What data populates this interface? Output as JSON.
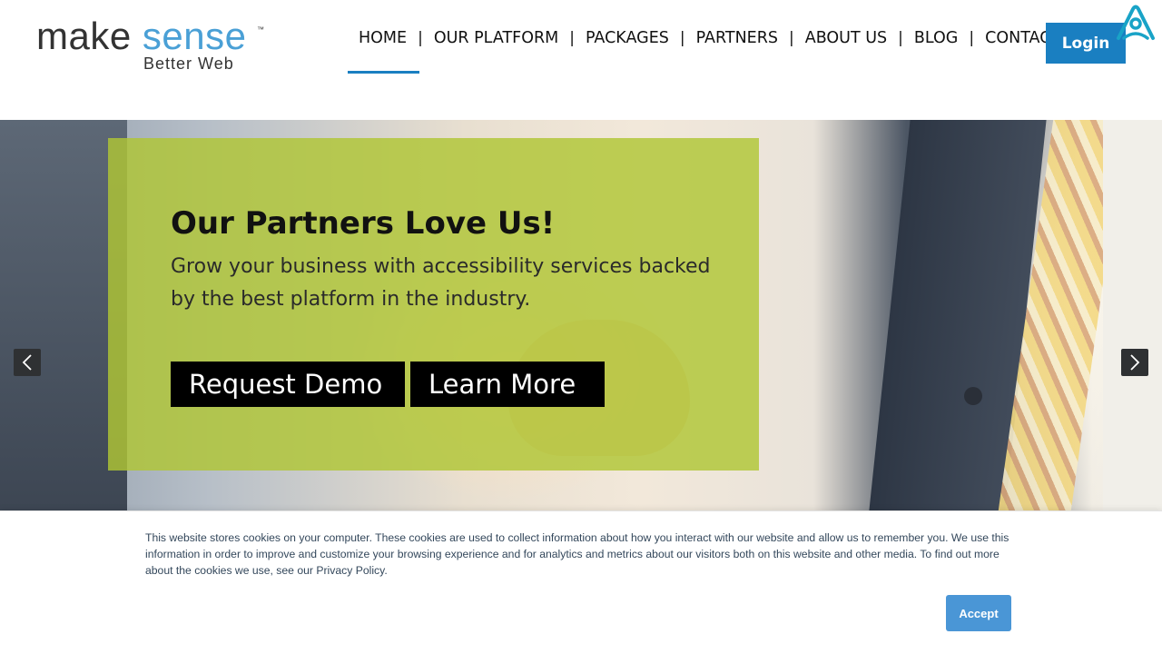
{
  "brand": {
    "logo_make": "make",
    "logo_sense": "sense",
    "logo_tm": "™",
    "logo_tagline": "Better Web",
    "accent_color": "#1a7fc1",
    "sense_color": "#4aa0d6"
  },
  "nav": {
    "items": [
      {
        "label": "HOME",
        "active": true
      },
      {
        "label": "OUR PLATFORM"
      },
      {
        "label": "PACKAGES"
      },
      {
        "label": "PARTNERS"
      },
      {
        "label": "ABOUT US"
      },
      {
        "label": "BLOG"
      },
      {
        "label": "CONTACT"
      }
    ],
    "separator": "|",
    "login_label": "Login",
    "accessibility_icon": "accessibility-icon"
  },
  "hero": {
    "title": "Our Partners Love Us!",
    "subtitle": "Grow your business with accessibility services backed by the best platform in the industry.",
    "primary_button": "Request Demo",
    "secondary_button": "Learn More",
    "overlay_color": "#b0c634",
    "prev_icon": "chevron-left-icon",
    "next_icon": "chevron-right-icon"
  },
  "cookie_banner": {
    "text": "This website stores cookies on your computer. These cookies are used to collect information about how you interact with our website and allow us to remember you. We use this information in order to improve and customize your browsing experience and for analytics and metrics about our visitors both on this website and other media. To find out more about the cookies we use, see our",
    "link_text": "Privacy Policy",
    "end_punct": ".",
    "accept_label": "Accept",
    "accept_color": "#4a96d6"
  }
}
